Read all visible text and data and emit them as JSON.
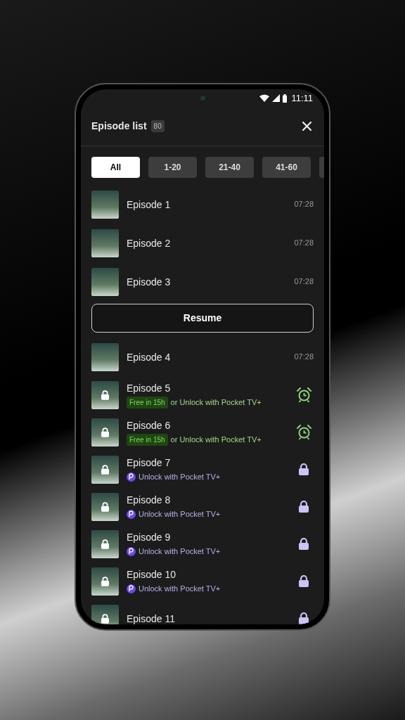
{
  "status_bar": {
    "time": "11:11"
  },
  "header": {
    "title": "Episode list",
    "count": "80"
  },
  "filters": [
    {
      "label": "All",
      "selected": true
    },
    {
      "label": "1-20",
      "selected": false
    },
    {
      "label": "21-40",
      "selected": false
    },
    {
      "label": "41-60",
      "selected": false
    }
  ],
  "items": [
    {
      "kind": "free",
      "title": "Episode 1",
      "duration": "07:28"
    },
    {
      "kind": "free",
      "title": "Episode 2",
      "duration": "07:28"
    },
    {
      "kind": "free",
      "title": "Episode 3",
      "duration": "07:28"
    },
    {
      "kind": "resume",
      "label": "Resume"
    },
    {
      "kind": "free",
      "title": "Episode 4",
      "duration": "07:28"
    },
    {
      "kind": "timed",
      "title": "Episode 5",
      "badge": "Free in 15h",
      "text": "or Unlock with Pocket TV+"
    },
    {
      "kind": "timed",
      "title": "Episode 6",
      "badge": "Free in 15h",
      "text": "or Unlock with Pocket TV+"
    },
    {
      "kind": "locked",
      "title": "Episode 7",
      "text": "Unlock with Pocket TV+"
    },
    {
      "kind": "locked",
      "title": "Episode 8",
      "text": "Unlock with Pocket TV+"
    },
    {
      "kind": "locked",
      "title": "Episode 9",
      "text": "Unlock with Pocket TV+"
    },
    {
      "kind": "locked",
      "title": "Episode 10",
      "text": "Unlock with Pocket TV+"
    },
    {
      "kind": "locked",
      "title": "Episode 11"
    }
  ]
}
